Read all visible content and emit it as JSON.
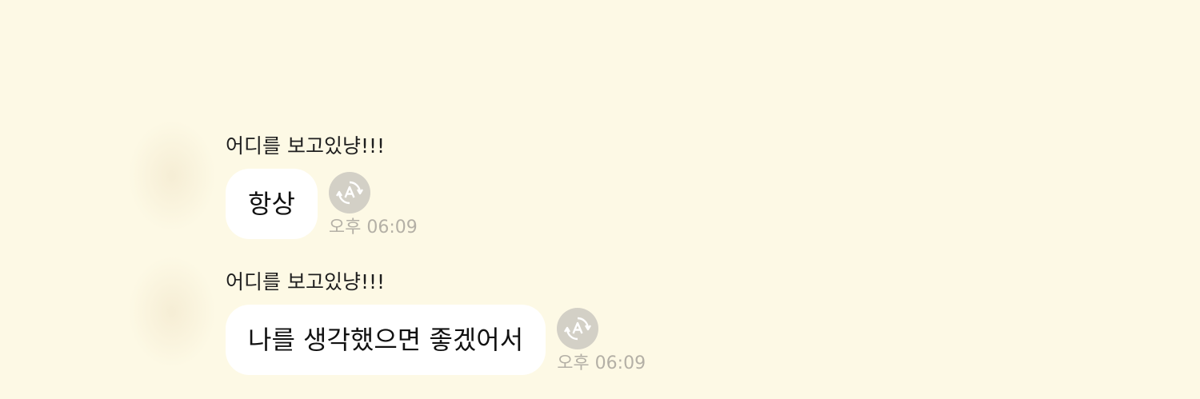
{
  "messages": [
    {
      "sender": "어디를 보고있냥!!!",
      "text": "항상",
      "time": "오후 06:09",
      "icon": "auto-translate-icon"
    },
    {
      "sender": "어디를 보고있냥!!!",
      "text": "나를 생각했으면 좋겠어서",
      "time": "오후 06:09",
      "icon": "auto-translate-icon"
    }
  ],
  "colors": {
    "background": "#fdf9e5",
    "bubble": "#ffffff",
    "time_text": "#b4b0a6",
    "icon_bg": "#d3d0c6"
  }
}
